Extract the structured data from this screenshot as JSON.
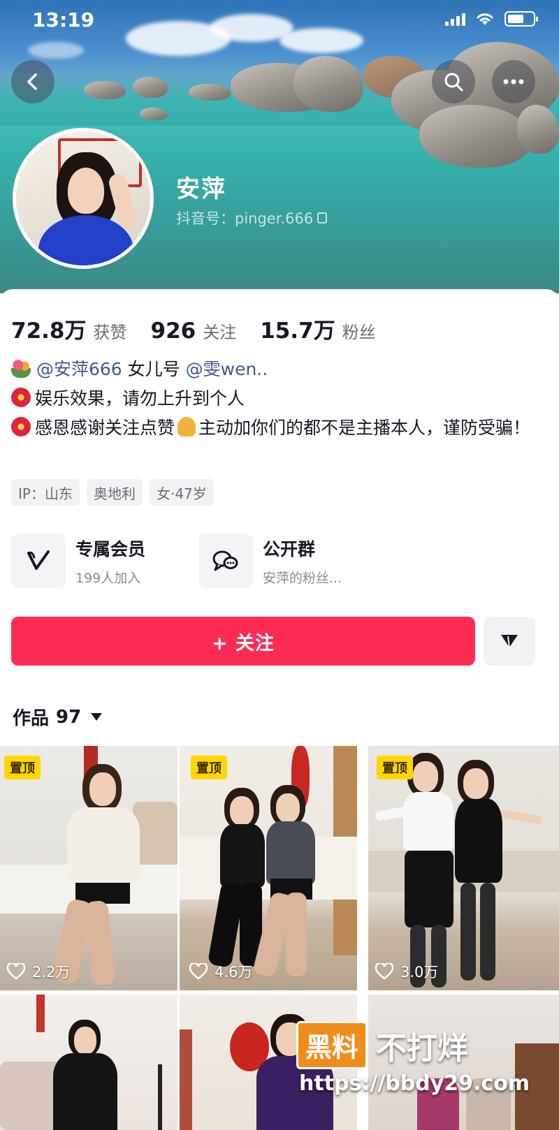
{
  "status_bar": {
    "time": "13:19"
  },
  "profile": {
    "name": "安萍",
    "douyin_id": "抖音号：pinger.666"
  },
  "stats": [
    {
      "value": "72.8万",
      "label": "获赞"
    },
    {
      "value": "926",
      "label": "关注"
    },
    {
      "value": "15.7万",
      "label": "粉丝"
    }
  ],
  "bio": {
    "line1_mention1": "@安萍666",
    "line1_mid": " 女儿号 ",
    "line1_mention2": "@雯wen..",
    "line2": "娱乐效果，请勿上升到个人",
    "line3_a": "感恩感谢关注点赞",
    "line3_b": "主动加你们的都不是主播本人，谨防受骗！"
  },
  "tags": [
    "IP：山东",
    "奥地利",
    "女·47岁"
  ],
  "features": [
    {
      "title": "专属会员",
      "subtitle": "199人加入",
      "icon": "vip-v-icon"
    },
    {
      "title": "公开群",
      "subtitle": "安萍的粉丝...",
      "icon": "group-chat-icon"
    }
  ],
  "follow_button": "+ 关注",
  "works": {
    "label": "作品",
    "count": "97"
  },
  "videos": [
    {
      "pinned": "置顶",
      "likes": "2.2万"
    },
    {
      "pinned": "置顶",
      "likes": "4.6万"
    },
    {
      "pinned": "置顶",
      "likes": "3.0万"
    },
    {
      "pinned": "",
      "likes": ""
    },
    {
      "pinned": "",
      "likes": ""
    },
    {
      "pinned": "",
      "likes": ""
    }
  ],
  "watermark": {
    "badge": "黑料",
    "text": "不打烊",
    "url": "https://bbdy29.com"
  },
  "colors": {
    "accent": "#fe2c55",
    "pin": "#ffd700",
    "mention": "#3b5a9a"
  }
}
